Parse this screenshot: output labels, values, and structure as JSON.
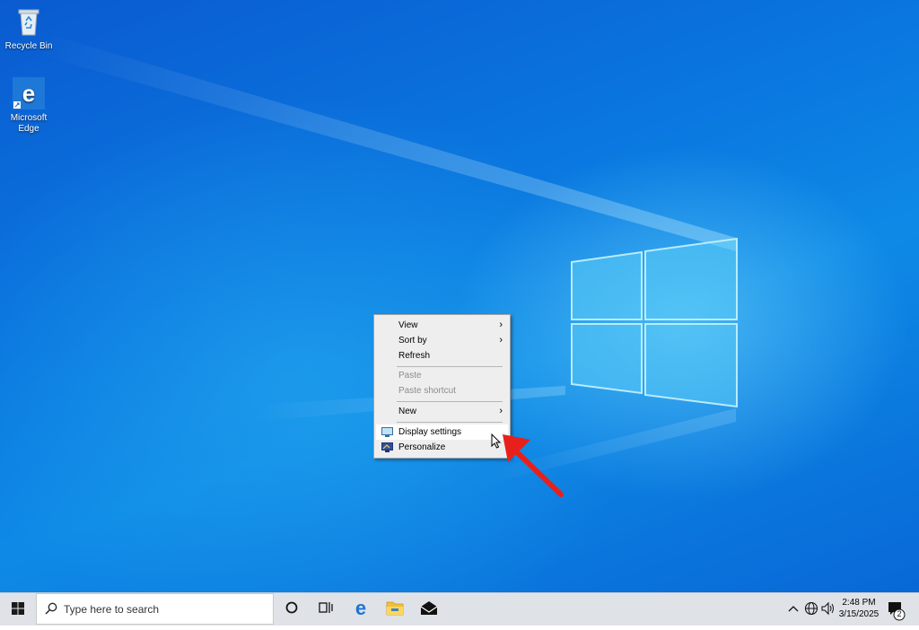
{
  "desktop": {
    "icons": [
      {
        "label": "Recycle Bin",
        "icon": "recycle-bin-icon"
      },
      {
        "label": "Microsoft Edge",
        "icon": "edge-icon"
      }
    ]
  },
  "context_menu": {
    "items": [
      {
        "label": "View",
        "submenu": true,
        "enabled": true
      },
      {
        "label": "Sort by",
        "submenu": true,
        "enabled": true
      },
      {
        "label": "Refresh",
        "submenu": false,
        "enabled": true
      },
      {
        "label": "Paste",
        "submenu": false,
        "enabled": false
      },
      {
        "label": "Paste shortcut",
        "submenu": false,
        "enabled": false
      },
      {
        "label": "New",
        "submenu": true,
        "enabled": true
      },
      {
        "label": "Display settings",
        "submenu": false,
        "enabled": true,
        "icon": "display-icon",
        "hovered": true
      },
      {
        "label": "Personalize",
        "submenu": false,
        "enabled": true,
        "icon": "personalize-icon"
      }
    ]
  },
  "taskbar": {
    "search_placeholder": "Type here to search",
    "time": "2:48 PM",
    "date": "3/15/2025",
    "notification_count": "2"
  },
  "colors": {
    "desktop_blue": "#0a78e0",
    "taskbar": "#dfe3e8",
    "arrow_red": "#e8201c"
  }
}
